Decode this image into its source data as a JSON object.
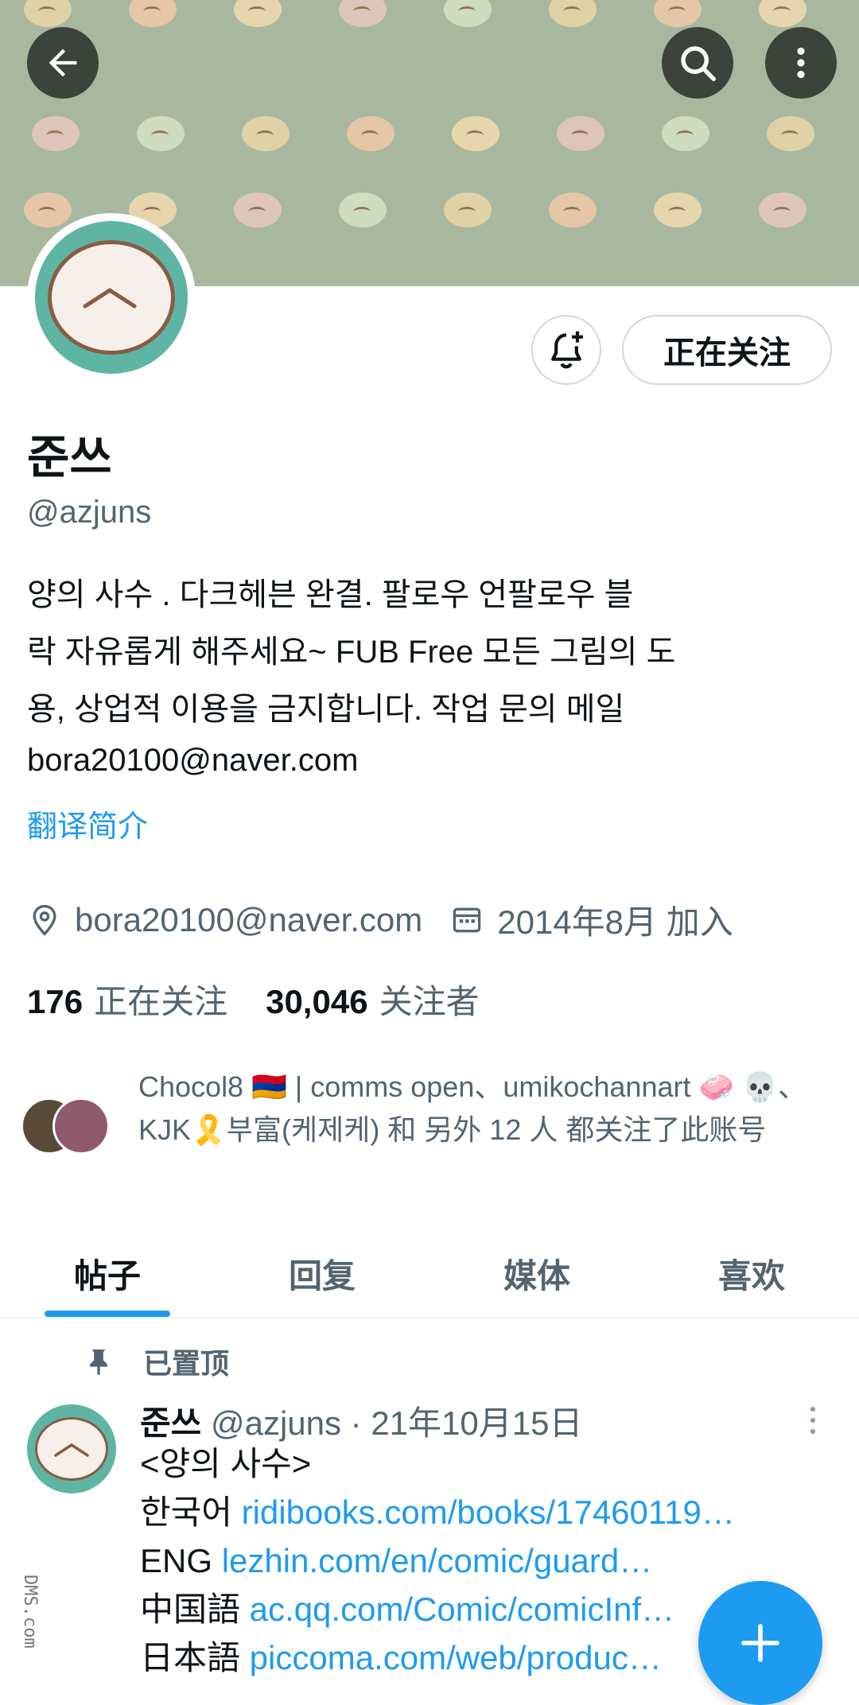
{
  "header": {
    "back_icon": "arrow-left-icon",
    "search_icon": "search-icon",
    "more_icon": "more-vertical-icon"
  },
  "profile": {
    "name": "준쓰",
    "handle": "@azjuns",
    "follow_label": "正在关注",
    "bio_lines": [
      "양의 사수 . 다크헤븐 완결. 팔로우 언팔로우 블",
      "락 자유롭게 해주세요~ FUB Free  모든 그림의 도",
      "용, 상업적 이용을 금지합니다. 작업 문의 메일",
      "bora20100@naver.com"
    ],
    "translate_label": "翻译简介",
    "location": "bora20100@naver.com",
    "joined": "2014年8月 加入",
    "following_count": "176",
    "following_label": "正在关注",
    "followers_count": "30,046",
    "followers_label": "关注者",
    "known_followers_text": "Chocol8 🇦🇲 | comms open、umikochannart 🧼 💀、KJK🎗️부富(케제케) 和 另外 12 人 都关注了此账号"
  },
  "tabs": [
    {
      "label": "帖子",
      "active": true
    },
    {
      "label": "回复",
      "active": false
    },
    {
      "label": "媒体",
      "active": false
    },
    {
      "label": "喜欢",
      "active": false
    }
  ],
  "pinned_label": "已置顶",
  "post": {
    "author": "준쓰",
    "handle_date": "@azjuns · 21年10月15日",
    "lines": [
      {
        "prefix": "<양의 사수>",
        "link": ""
      },
      {
        "prefix": "한국어 ",
        "link": "ridibooks.com/books/17460119…"
      },
      {
        "prefix": "ENG ",
        "link": "lezhin.com/en/comic/guard…"
      },
      {
        "prefix": "中国語 ",
        "link": "ac.qq.com/Comic/comicInf…"
      },
      {
        "prefix": "日本語 ",
        "link": "piccoma.com/web/produc…"
      }
    ]
  },
  "fab_icon": "plus-icon",
  "watermark": "DMS.com",
  "colors": {
    "accent": "#1d9bf0",
    "muted": "#536471",
    "text": "#0f1419",
    "banner": "#a8b89f",
    "avatar_bg": "#5fb5a3"
  }
}
